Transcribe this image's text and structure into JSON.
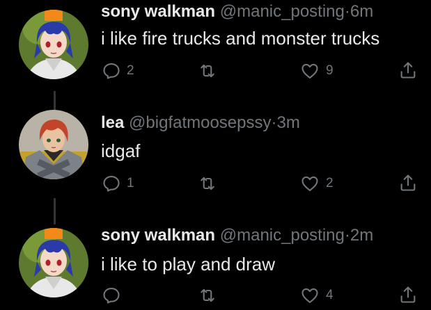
{
  "theme": {
    "background": "#000000",
    "text": "#e7e9ea",
    "muted": "#71767b",
    "thread_line": "#333639"
  },
  "tweets": [
    {
      "name": "sony walkman",
      "handle": "@manic_posting",
      "separator": "·",
      "time": "6m",
      "text": "i like fire trucks and monster trucks",
      "avatar": "blue-haired-anime-avatar",
      "actions": {
        "reply_count": "2",
        "retweet_count": "",
        "like_count": "9",
        "share_count": ""
      }
    },
    {
      "name": "lea",
      "handle": "@bigfatmoosepssy",
      "separator": "·",
      "time": "3m",
      "text": "idgaf",
      "avatar": "red-haired-armored-anime-avatar",
      "actions": {
        "reply_count": "1",
        "retweet_count": "",
        "like_count": "2",
        "share_count": ""
      }
    },
    {
      "name": "sony walkman",
      "handle": "@manic_posting",
      "separator": "·",
      "time": "2m",
      "text": "i like to play and draw",
      "avatar": "blue-haired-anime-avatar",
      "actions": {
        "reply_count": "",
        "retweet_count": "",
        "like_count": "4",
        "share_count": ""
      }
    }
  ],
  "icons": {
    "reply": "reply-icon",
    "retweet": "retweet-icon",
    "like": "heart-icon",
    "share": "share-icon"
  }
}
